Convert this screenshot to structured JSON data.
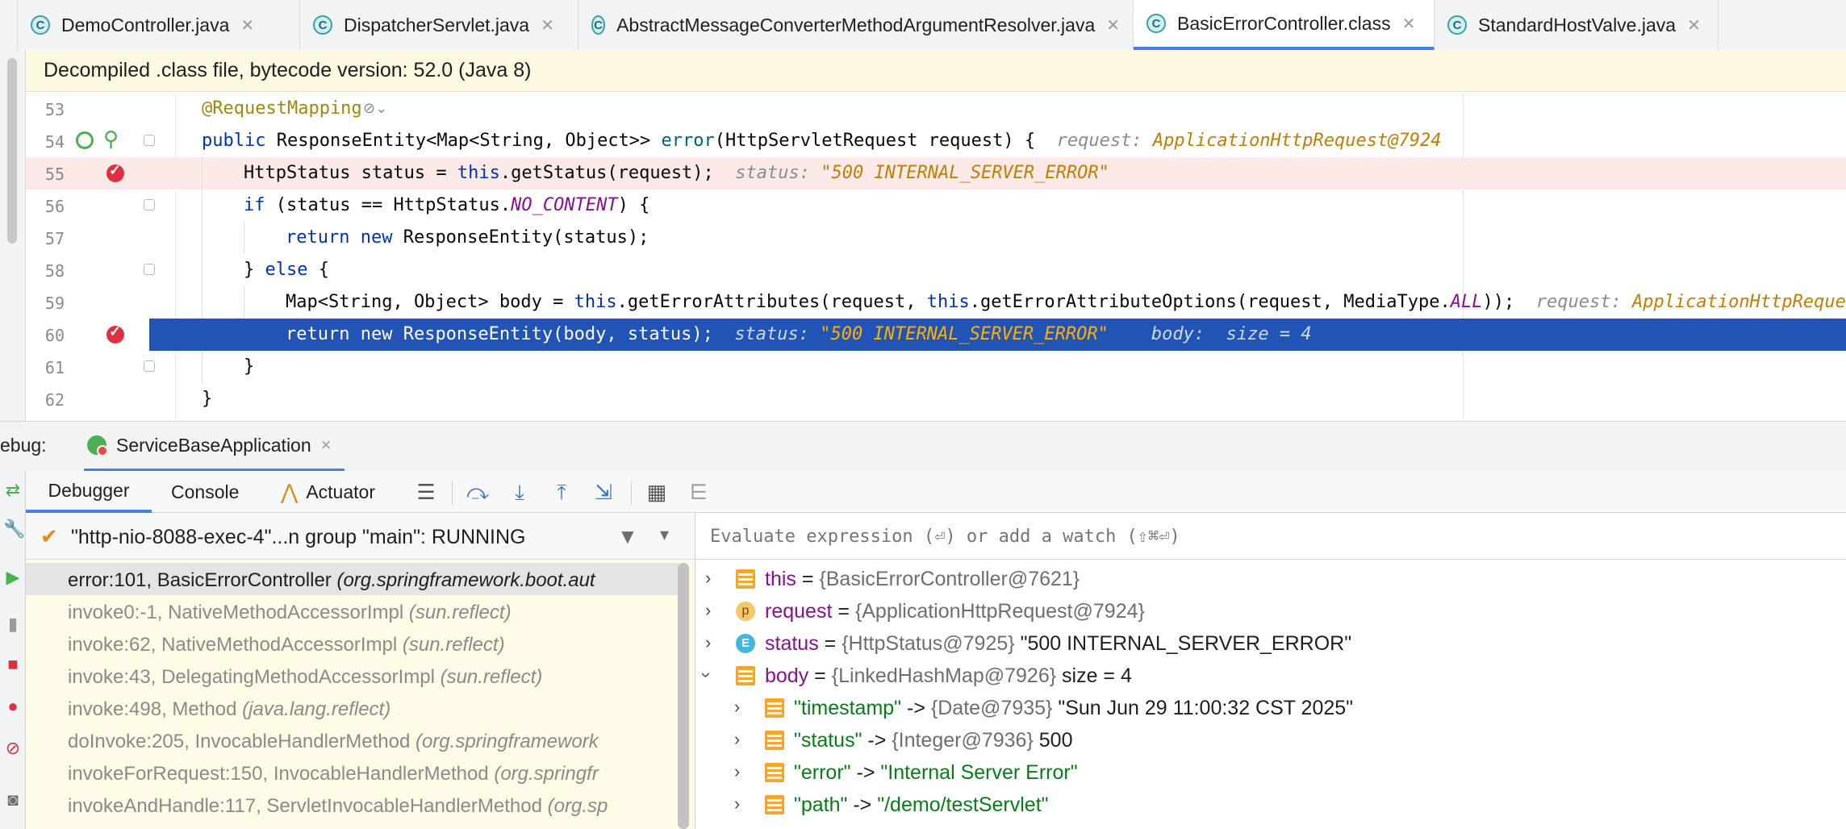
{
  "editor_tabs": [
    {
      "label": "DemoController.java",
      "icon": "class-icon",
      "active": false
    },
    {
      "label": "DispatcherServlet.java",
      "icon": "class-icon",
      "active": false
    },
    {
      "label": "AbstractMessageConverterMethodArgumentResolver.java",
      "icon": "class-icon",
      "active": false
    },
    {
      "label": "BasicErrorController.class",
      "icon": "class-icon",
      "active": true
    },
    {
      "label": "StandardHostValve.java",
      "icon": "class-icon",
      "active": false
    }
  ],
  "banner": {
    "text": "Decompiled .class file, bytecode version: 52.0 (Java 8)"
  },
  "code": {
    "line_numbers": [
      "53",
      "54",
      "55",
      "56",
      "57",
      "58",
      "59",
      "60",
      "61",
      "62"
    ],
    "l53": {
      "annotation": "@RequestMapping"
    },
    "l54": {
      "kw1": "public ",
      "t1": "ResponseEntity<Map<String, Object>> ",
      "fn": "error",
      "t2": "(HttpServletRequest request) {",
      "hint_label": "request: ",
      "hint_value": "ApplicationHttpRequest@7924"
    },
    "l55": {
      "t1": "HttpStatus status = ",
      "kw": "this",
      "t2": ".getStatus(request);",
      "hint_label": "status: ",
      "hint_value": "\"500 INTERNAL_SERVER_ERROR\""
    },
    "l56": {
      "kw": "if",
      "t1": " (status == HttpStatus.",
      "const": "NO_CONTENT",
      "t2": ") {"
    },
    "l57": {
      "kw1": "return ",
      "kw2": "new ",
      "t1": "ResponseEntity(status);"
    },
    "l58": {
      "t1": "} ",
      "kw": "else",
      "t2": " {"
    },
    "l59": {
      "t1": "Map<String, Object> body = ",
      "kw1": "this",
      "t2": ".getErrorAttributes(request, ",
      "kw2": "this",
      "t3": ".getErrorAttributeOptions(request, MediaType.",
      "const": "ALL",
      "t4": "));",
      "hint_label": "request: ",
      "hint_value": "ApplicationHttpReques"
    },
    "l60": {
      "kw1": "return ",
      "kw2": "new ",
      "t1": "ResponseEntity(body, status);",
      "hint_label": "status: ",
      "hint_value": "\"500 INTERNAL_SERVER_ERROR\"",
      "hint2": "body:  size = 4"
    },
    "l61": {
      "t1": "}"
    },
    "l62": {
      "t1": "}"
    }
  },
  "debug_header": {
    "label": "ebug:",
    "run_config": "ServiceBaseApplication",
    "close": "×"
  },
  "debugger_tabs": [
    "Debugger",
    "Console",
    "Actuator"
  ],
  "thread": {
    "text": "\"http-nio-8088-exec-4\"...n group \"main\": RUNNING"
  },
  "frames": [
    {
      "method": "error:101, BasicErrorController ",
      "pkg": "(org.springframework.boot.aut",
      "current": true
    },
    {
      "method": "invoke0:-1, NativeMethodAccessorImpl ",
      "pkg": "(sun.reflect)",
      "current": false
    },
    {
      "method": "invoke:62, NativeMethodAccessorImpl ",
      "pkg": "(sun.reflect)",
      "current": false
    },
    {
      "method": "invoke:43, DelegatingMethodAccessorImpl ",
      "pkg": "(sun.reflect)",
      "current": false
    },
    {
      "method": "invoke:498, Method ",
      "pkg": "(java.lang.reflect)",
      "current": false
    },
    {
      "method": "doInvoke:205, InvocableHandlerMethod ",
      "pkg": "(org.springframework",
      "current": false
    },
    {
      "method": "invokeForRequest:150, InvocableHandlerMethod ",
      "pkg": "(org.springfr",
      "current": false
    },
    {
      "method": "invokeAndHandle:117, ServletInvocableHandlerMethod ",
      "pkg": "(org.sp",
      "current": false
    }
  ],
  "evaluate": {
    "placeholder": "Evaluate expression (⏎) or add a watch (⇧⌘⏎)"
  },
  "variables": [
    {
      "name": "this",
      "eq": " = ",
      "type": "{BasicErrorController@7621}",
      "value": "",
      "icon": "field-icon",
      "expanded": false
    },
    {
      "name": "request",
      "eq": " = ",
      "type": "{ApplicationHttpRequest@7924}",
      "value": "",
      "icon": "parameter-icon",
      "expanded": false
    },
    {
      "name": "status",
      "eq": " = ",
      "type": "{HttpStatus@7925} ",
      "value": "\"500 INTERNAL_SERVER_ERROR\"",
      "icon": "enum-icon",
      "expanded": false
    },
    {
      "name": "body",
      "eq": " = ",
      "type": "{LinkedHashMap@7926} ",
      "value": " size = 4",
      "icon": "field-icon",
      "expanded": true
    }
  ],
  "body_entries": [
    {
      "key": "\"timestamp\"",
      "arrow": " -> ",
      "type": "{Date@7935} ",
      "value": "\"Sun Jun 29 11:00:32 CST 2025\"",
      "green": false
    },
    {
      "key": "\"status\"",
      "arrow": " -> ",
      "type": "{Integer@7936} ",
      "value": "500",
      "green": false
    },
    {
      "key": "\"error\"",
      "arrow": " -> ",
      "type": "",
      "value": "\"Internal Server Error\"",
      "green": true
    },
    {
      "key": "\"path\"",
      "arrow": " -> ",
      "type": "",
      "value": "\"/demo/testServlet\"",
      "green": true
    }
  ],
  "colors": {
    "accent": "#4b7de8",
    "selection": "#2154b5",
    "breakpoint": "#e03040",
    "frames_bg": "#fffbe6"
  }
}
